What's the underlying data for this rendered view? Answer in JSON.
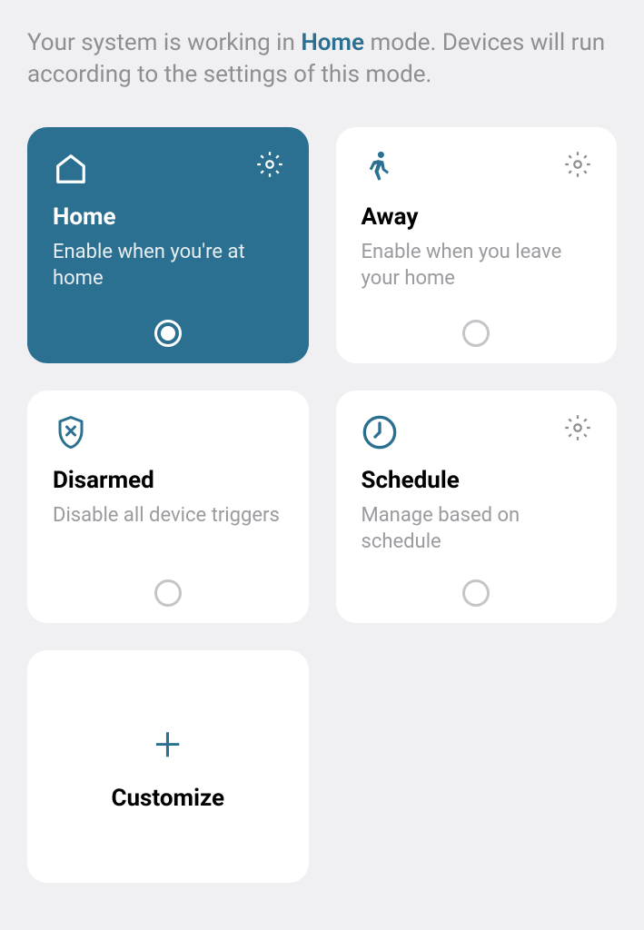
{
  "header": {
    "text_before": "Your system is working in ",
    "mode": "Home",
    "text_after": " mode. Devices will run according to the settings of this mode."
  },
  "cards": {
    "home": {
      "title": "Home",
      "description": "Enable when you're at home",
      "active": true,
      "has_gear": true
    },
    "away": {
      "title": "Away",
      "description": "Enable when you leave your home",
      "active": false,
      "has_gear": true
    },
    "disarmed": {
      "title": "Disarmed",
      "description": "Disable all device triggers",
      "active": false,
      "has_gear": false
    },
    "schedule": {
      "title": "Schedule",
      "description": "Manage based on schedule",
      "active": false,
      "has_gear": true
    },
    "customize": {
      "title": "Customize"
    }
  },
  "colors": {
    "accent": "#2c7091",
    "text_muted": "#8e8e93",
    "card_bg": "#ffffff",
    "page_bg": "#f0f0f2"
  }
}
